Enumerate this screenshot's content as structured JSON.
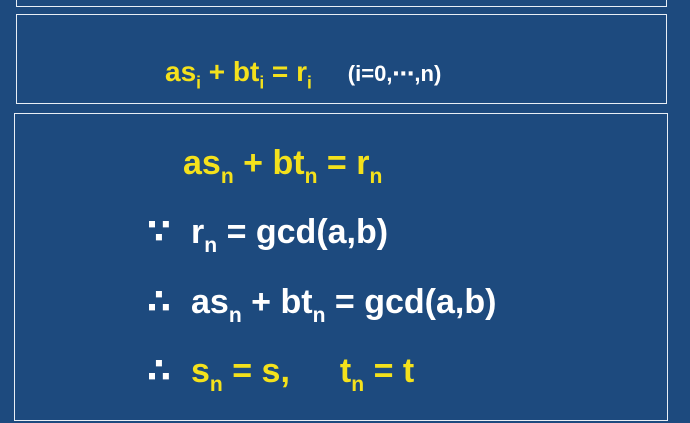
{
  "slide": {
    "box1": {
      "equation": {
        "as": "as",
        "sub_i_1": "i",
        "plus_bt": " + bt",
        "sub_i_2": "i",
        "eq_r": " = r",
        "sub_i_3": "i",
        "range": "(i=0,⋯,n)"
      }
    },
    "box2": {
      "line1": {
        "as": "as",
        "sub1": "n",
        "plus_bt": " + bt",
        "sub2": "n",
        "eq_r": " = r",
        "sub3": "n"
      },
      "line2": {
        "symbol": "∵",
        "r": "r",
        "sub": "n",
        "rest": " = gcd(a,b)"
      },
      "line3": {
        "symbol": "∴",
        "as": "as",
        "sub1": "n",
        "plus_bt": " + bt",
        "sub2": "n",
        "rest": " = gcd(a,b)"
      },
      "line4": {
        "symbol": "∴",
        "s": "s",
        "sub1": "n",
        "eq_s": " = s,",
        "t": "t",
        "sub2": "n",
        "eq_t": " = t"
      }
    }
  },
  "colors": {
    "background": "#1d4a7e",
    "highlight": "#f4e11c",
    "text": "#ffffff",
    "border": "#e8eef5"
  }
}
